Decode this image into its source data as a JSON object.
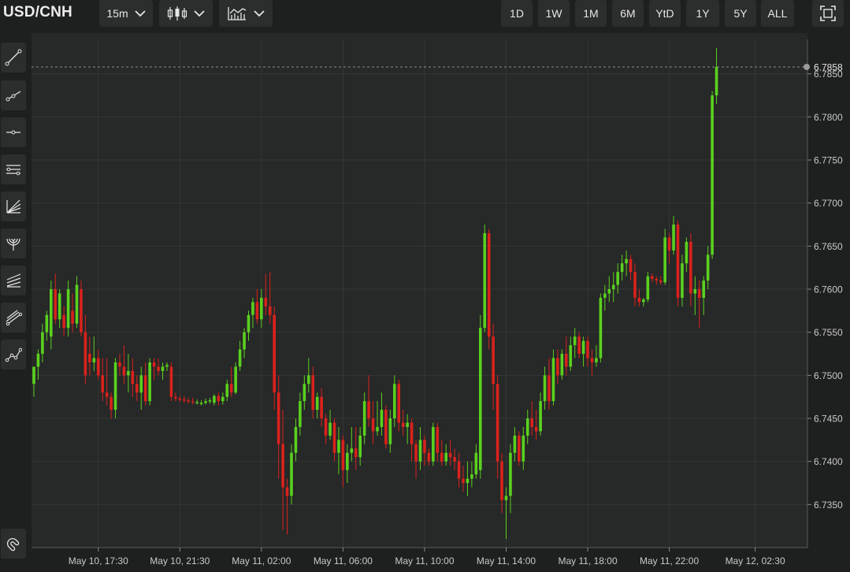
{
  "header": {
    "symbol": "USD/CNH",
    "interval": "15m",
    "chart_type_icon": "candlestick-icon",
    "indicators_icon": "indicators-icon",
    "ranges": [
      "1D",
      "1W",
      "1M",
      "6M",
      "YtD",
      "1Y",
      "5Y",
      "ALL"
    ],
    "fullscreen_icon": "fullscreen-icon"
  },
  "tools": [
    "trend-line-icon",
    "ray-icon",
    "horizontal-line-icon",
    "parallel-channel-icon",
    "fibonacci-fan-icon",
    "fibonacci-arc-icon",
    "pitchfork-icon",
    "regression-channel-icon",
    "polyline-icon",
    "magnet-icon"
  ],
  "colors": {
    "up": "#5ad11e",
    "down": "#d9221c",
    "grid": "#353636",
    "axis": "#c9c9c9",
    "background": "#272828"
  },
  "chart_data": {
    "type": "candlestick",
    "title": "USD/CNH",
    "interval": "15m",
    "ylim": [
      6.73,
      6.789
    ],
    "y_ticks": [
      6.735,
      6.74,
      6.745,
      6.75,
      6.755,
      6.76,
      6.765,
      6.77,
      6.775,
      6.78,
      6.785
    ],
    "x_ticks": [
      "May 10, 17:30",
      "May 10, 21:30",
      "May 11, 02:00",
      "May 11, 06:00",
      "May 11, 10:00",
      "May 11, 14:00",
      "May 11, 18:00",
      "May 11, 22:00",
      "May 12, 02:30"
    ],
    "last_price": 6.7858,
    "grid": true,
    "ohlc": [
      [
        6.749,
        6.751,
        6.7475,
        6.751
      ],
      [
        6.751,
        6.753,
        6.7495,
        6.7525
      ],
      [
        6.7525,
        6.756,
        6.7515,
        6.755
      ],
      [
        6.755,
        6.7575,
        6.754,
        6.757
      ],
      [
        6.7545,
        6.761,
        6.753,
        6.76
      ],
      [
        6.76,
        6.7618,
        6.756,
        6.7565
      ],
      [
        6.7565,
        6.76,
        6.7555,
        6.7595
      ],
      [
        6.757,
        6.758,
        6.7545,
        6.7555
      ],
      [
        6.7555,
        6.761,
        6.7545,
        6.76
      ],
      [
        6.7575,
        6.7595,
        6.755,
        6.756
      ],
      [
        6.756,
        6.7615,
        6.7555,
        6.7605
      ],
      [
        6.76,
        6.761,
        6.7545,
        6.755
      ],
      [
        6.755,
        6.757,
        6.749,
        6.75
      ],
      [
        6.7525,
        6.7545,
        6.75,
        6.7515
      ],
      [
        6.7515,
        6.7545,
        6.7505,
        6.752
      ],
      [
        6.752,
        6.753,
        6.7495,
        6.75
      ],
      [
        6.75,
        6.752,
        6.747,
        6.748
      ],
      [
        6.748,
        6.752,
        6.7465,
        6.7475
      ],
      [
        6.7475,
        6.748,
        6.745,
        6.746
      ],
      [
        6.746,
        6.752,
        6.745,
        6.7515
      ],
      [
        6.7515,
        6.7525,
        6.75,
        6.751
      ],
      [
        6.751,
        6.7535,
        6.749,
        6.75
      ],
      [
        6.75,
        6.7525,
        6.748,
        6.7505
      ],
      [
        6.7505,
        6.752,
        6.7475,
        6.749
      ],
      [
        6.749,
        6.75,
        6.747,
        6.748
      ],
      [
        6.748,
        6.751,
        6.746,
        6.75
      ],
      [
        6.75,
        6.7515,
        6.7465,
        6.747
      ],
      [
        6.747,
        6.752,
        6.7465,
        6.7515
      ],
      [
        6.7515,
        6.752,
        6.7495,
        6.751
      ],
      [
        6.751,
        6.752,
        6.75,
        6.7505
      ],
      [
        6.7505,
        6.7515,
        6.7495,
        6.751
      ],
      [
        6.751,
        6.7515,
        6.7505,
        6.7512
      ],
      [
        6.751,
        6.7515,
        6.747,
        6.7475
      ],
      [
        6.7475,
        6.748,
        6.747,
        6.7473
      ],
      [
        6.7473,
        6.7476,
        6.7469,
        6.7472
      ],
      [
        6.7472,
        6.7476,
        6.7468,
        6.7471
      ],
      [
        6.7471,
        6.7474,
        6.7467,
        6.747
      ],
      [
        6.747,
        6.7474,
        6.7466,
        6.7469
      ],
      [
        6.7469,
        6.7472,
        6.7466,
        6.7469
      ],
      [
        6.7468,
        6.7471,
        6.7465,
        6.7468
      ],
      [
        6.7468,
        6.7473,
        6.7466,
        6.747
      ],
      [
        6.747,
        6.7474,
        6.7467,
        6.7471
      ],
      [
        6.7468,
        6.7478,
        6.7465,
        6.7476
      ],
      [
        6.7476,
        6.748,
        6.7465,
        6.747
      ],
      [
        6.747,
        6.748,
        6.7466,
        6.7475
      ],
      [
        6.7475,
        6.7495,
        6.747,
        6.749
      ],
      [
        6.749,
        6.751,
        6.7475,
        6.748
      ],
      [
        6.748,
        6.7515,
        6.7478,
        6.751
      ],
      [
        6.751,
        6.754,
        6.7505,
        6.753
      ],
      [
        6.753,
        6.7555,
        6.752,
        6.755
      ],
      [
        6.755,
        6.7575,
        6.754,
        6.757
      ],
      [
        6.757,
        6.759,
        6.7555,
        6.7585
      ],
      [
        6.7585,
        6.76,
        6.756,
        6.7565
      ],
      [
        6.7565,
        6.76,
        6.7555,
        6.759
      ],
      [
        6.759,
        6.7618,
        6.757,
        6.758
      ],
      [
        6.758,
        6.762,
        6.756,
        6.757
      ],
      [
        6.757,
        6.758,
        6.746,
        6.748
      ],
      [
        6.748,
        6.75,
        6.738,
        6.742
      ],
      [
        6.742,
        6.746,
        6.732,
        6.737
      ],
      [
        6.737,
        6.738,
        6.7315,
        6.736
      ],
      [
        6.736,
        6.742,
        6.735,
        6.741
      ],
      [
        6.741,
        6.745,
        6.74,
        6.744
      ],
      [
        6.744,
        6.748,
        6.743,
        6.747
      ],
      [
        6.747,
        6.75,
        6.746,
        6.749
      ],
      [
        6.749,
        6.752,
        6.748,
        6.75
      ],
      [
        6.75,
        6.751,
        6.745,
        6.746
      ],
      [
        6.746,
        6.748,
        6.745,
        6.7475
      ],
      [
        6.7475,
        6.7485,
        6.744,
        6.745
      ],
      [
        6.745,
        6.7455,
        6.742,
        6.743
      ],
      [
        6.743,
        6.746,
        6.7425,
        6.7445
      ],
      [
        6.7445,
        6.745,
        6.74,
        6.741
      ],
      [
        6.741,
        6.744,
        6.7385,
        6.7425
      ],
      [
        6.7425,
        6.743,
        6.737,
        6.739
      ],
      [
        6.739,
        6.742,
        6.7375,
        6.741
      ],
      [
        6.741,
        6.744,
        6.74,
        6.7415
      ],
      [
        6.7415,
        6.744,
        6.739,
        6.7405
      ],
      [
        6.7405,
        6.744,
        6.7395,
        6.743
      ],
      [
        6.743,
        6.748,
        6.742,
        6.747
      ],
      [
        6.747,
        6.75,
        6.744,
        6.745
      ],
      [
        6.745,
        6.747,
        6.742,
        6.7435
      ],
      [
        6.7435,
        6.747,
        6.743,
        6.744
      ],
      [
        6.744,
        6.748,
        6.743,
        6.746
      ],
      [
        6.746,
        6.7465,
        6.7415,
        6.742
      ],
      [
        6.742,
        6.746,
        6.741,
        6.745
      ],
      [
        6.745,
        6.75,
        6.744,
        6.749
      ],
      [
        6.749,
        6.7495,
        6.7435,
        6.7445
      ],
      [
        6.7445,
        6.746,
        6.743,
        6.744
      ],
      [
        6.744,
        6.7455,
        6.742,
        6.7445
      ],
      [
        6.7445,
        6.745,
        6.74,
        6.742
      ],
      [
        6.742,
        6.7425,
        6.738,
        6.74
      ],
      [
        6.74,
        6.744,
        6.739,
        6.7425
      ],
      [
        6.7425,
        6.743,
        6.7395,
        6.741
      ],
      [
        6.741,
        6.7415,
        6.7395,
        6.74
      ],
      [
        6.74,
        6.7445,
        6.7395,
        6.744
      ],
      [
        6.744,
        6.7445,
        6.74,
        6.741
      ],
      [
        6.741,
        6.7425,
        6.7395,
        6.74
      ],
      [
        6.74,
        6.742,
        6.7395,
        6.741
      ],
      [
        6.741,
        6.7425,
        6.7395,
        6.7405
      ],
      [
        6.7405,
        6.7415,
        6.739,
        6.74
      ],
      [
        6.74,
        6.741,
        6.737,
        6.738
      ],
      [
        6.738,
        6.7395,
        6.7365,
        6.7375
      ],
      [
        6.7375,
        6.74,
        6.736,
        6.738
      ],
      [
        6.738,
        6.74,
        6.737,
        6.7385
      ],
      [
        6.7385,
        6.742,
        6.738,
        6.741
      ],
      [
        6.739,
        6.757,
        6.738,
        6.7555
      ],
      [
        6.7555,
        6.7675,
        6.755,
        6.7665
      ],
      [
        6.7665,
        6.767,
        6.753,
        6.7545
      ],
      [
        6.7545,
        6.756,
        6.746,
        6.749
      ],
      [
        6.749,
        6.75,
        6.738,
        6.74
      ],
      [
        6.74,
        6.741,
        6.734,
        6.7355
      ],
      [
        6.7355,
        6.737,
        6.731,
        6.736
      ],
      [
        6.736,
        6.742,
        6.734,
        6.741
      ],
      [
        6.741,
        6.744,
        6.74,
        6.743
      ],
      [
        6.743,
        6.7435,
        6.7395,
        6.74
      ],
      [
        6.74,
        6.744,
        6.739,
        6.743
      ],
      [
        6.743,
        6.746,
        6.742,
        6.745
      ],
      [
        6.745,
        6.747,
        6.743,
        6.744
      ],
      [
        6.744,
        6.746,
        6.7425,
        6.7435
      ],
      [
        6.7435,
        6.748,
        6.743,
        6.747
      ],
      [
        6.747,
        6.751,
        6.746,
        6.75
      ],
      [
        6.75,
        6.752,
        6.746,
        6.747
      ],
      [
        6.747,
        6.753,
        6.7465,
        6.752
      ],
      [
        6.752,
        6.753,
        6.749,
        6.75
      ],
      [
        6.75,
        6.753,
        6.7495,
        6.7525
      ],
      [
        6.7525,
        6.7545,
        6.75,
        6.751
      ],
      [
        6.751,
        6.7545,
        6.7505,
        6.7535
      ],
      [
        6.7535,
        6.7555,
        6.752,
        6.7545
      ],
      [
        6.7545,
        6.755,
        6.752,
        6.7525
      ],
      [
        6.7525,
        6.7545,
        6.751,
        6.754
      ],
      [
        6.754,
        6.7545,
        6.751,
        6.752
      ],
      [
        6.752,
        6.753,
        6.75,
        6.7515
      ],
      [
        6.7515,
        6.7535,
        6.751,
        6.752
      ],
      [
        6.752,
        6.7595,
        6.7515,
        6.759
      ],
      [
        6.759,
        6.7605,
        6.7575,
        6.7595
      ],
      [
        6.7595,
        6.7615,
        6.7585,
        6.76
      ],
      [
        6.76,
        6.762,
        6.7585,
        6.7605
      ],
      [
        6.7605,
        6.763,
        6.7595,
        6.762
      ],
      [
        6.762,
        6.764,
        6.761,
        6.763
      ],
      [
        6.763,
        6.7645,
        6.7615,
        6.7635
      ],
      [
        6.7635,
        6.764,
        6.761,
        6.762
      ],
      [
        6.762,
        6.763,
        6.758,
        6.759
      ],
      [
        6.759,
        6.76,
        6.758,
        6.7585
      ],
      [
        6.7585,
        6.759,
        6.758,
        6.7588
      ],
      [
        6.7588,
        6.762,
        6.7585,
        6.7615
      ],
      [
        6.7615,
        6.7618,
        6.7608,
        6.7612
      ],
      [
        6.7612,
        6.7615,
        6.7605,
        6.761
      ],
      [
        6.761,
        6.7615,
        6.7605,
        6.7608
      ],
      [
        6.7608,
        6.767,
        6.7605,
        6.766
      ],
      [
        6.766,
        6.7665,
        6.763,
        6.7645
      ],
      [
        6.7645,
        6.7685,
        6.764,
        6.7675
      ],
      [
        6.7675,
        6.768,
        6.758,
        6.759
      ],
      [
        6.759,
        6.764,
        6.758,
        6.763
      ],
      [
        6.763,
        6.766,
        6.762,
        6.7655
      ],
      [
        6.7655,
        6.7665,
        6.758,
        6.7595
      ],
      [
        6.7595,
        6.7615,
        6.757,
        6.76
      ],
      [
        6.76,
        6.761,
        6.7555,
        6.759
      ],
      [
        6.759,
        6.7615,
        6.757,
        6.761
      ],
      [
        6.761,
        6.765,
        6.76,
        6.764
      ],
      [
        6.764,
        6.783,
        6.7635,
        6.7825
      ],
      [
        6.7825,
        6.788,
        6.7815,
        6.7858
      ]
    ]
  }
}
